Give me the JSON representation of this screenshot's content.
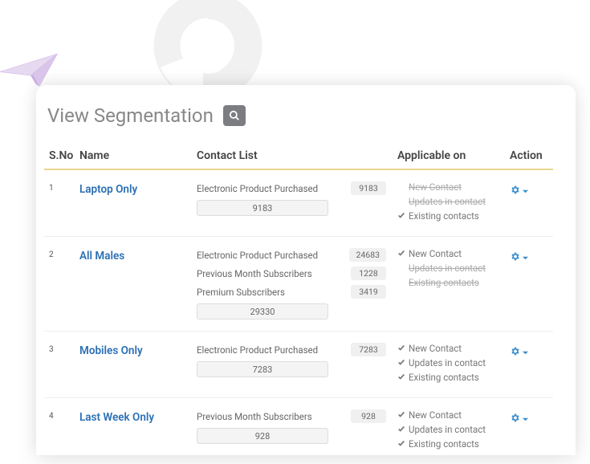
{
  "page_title": "View Segmentation",
  "columns": {
    "sno": "S.No",
    "name": "Name",
    "list": "Contact List",
    "applicable": "Applicable on",
    "action": "Action"
  },
  "applicable_labels": {
    "new": "New Contact",
    "updates": "Updates in contact",
    "existing": "Existing contacts"
  },
  "rows": [
    {
      "sno": "1",
      "name": "Laptop Only",
      "lists": [
        {
          "label": "Electronic Product Purchased",
          "count": "9183"
        }
      ],
      "total": "9183",
      "applicable": {
        "new": false,
        "updates": false,
        "existing": true
      }
    },
    {
      "sno": "2",
      "name": "All Males",
      "lists": [
        {
          "label": "Electronic Product Purchased",
          "count": "24683"
        },
        {
          "label": "Previous Month Subscribers",
          "count": "1228"
        },
        {
          "label": "Premium Subscribers",
          "count": "3419"
        }
      ],
      "total": "29330",
      "applicable": {
        "new": true,
        "updates": false,
        "existing": false
      }
    },
    {
      "sno": "3",
      "name": "Mobiles Only",
      "lists": [
        {
          "label": "Electronic Product Purchased",
          "count": "7283"
        }
      ],
      "total": "7283",
      "applicable": {
        "new": true,
        "updates": true,
        "existing": true
      }
    },
    {
      "sno": "4",
      "name": "Last Week Only",
      "lists": [
        {
          "label": "Previous Month Subscribers",
          "count": "928"
        }
      ],
      "total": "928",
      "applicable": {
        "new": true,
        "updates": true,
        "existing": true
      }
    }
  ],
  "colors": {
    "accent": "#3a8fcf",
    "gear": "#3a8fcf"
  }
}
